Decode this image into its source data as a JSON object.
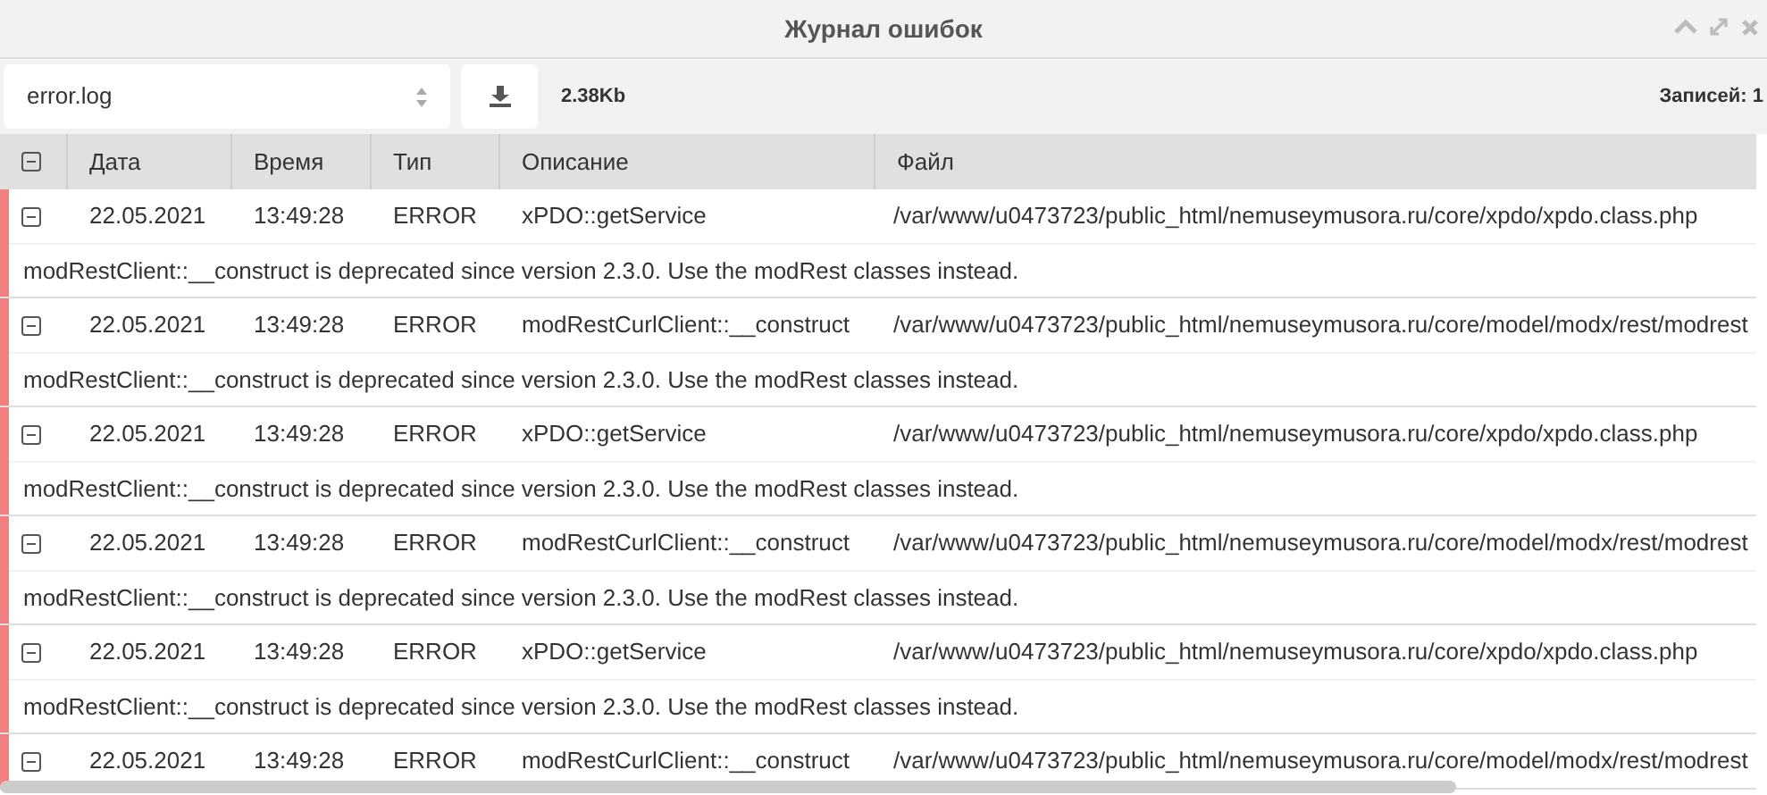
{
  "window": {
    "title": "Журнал ошибок"
  },
  "toolbar": {
    "file_select": {
      "value": "error.log"
    },
    "file_size": "2.38Kb",
    "records": "Записей: 1"
  },
  "table": {
    "columns": [
      "Дата",
      "Время",
      "Тип",
      "Описание",
      "Файл"
    ],
    "rows": [
      {
        "date": "22.05.2021",
        "time": "13:49:28",
        "type": "ERROR",
        "description": "xPDO::getService",
        "file": "/var/www/u0473723/public_html/nemuseymusora.ru/core/xpdo/xpdo.class.php",
        "expanded": true,
        "message": "modRestClient::__construct is deprecated since version 2.3.0. Use the modRest classes instead."
      },
      {
        "date": "22.05.2021",
        "time": "13:49:28",
        "type": "ERROR",
        "description": "modRestCurlClient::__construct",
        "file": "/var/www/u0473723/public_html/nemuseymusora.ru/core/model/modx/rest/modrest",
        "expanded": true,
        "message": "modRestClient::__construct is deprecated since version 2.3.0. Use the modRest classes instead."
      },
      {
        "date": "22.05.2021",
        "time": "13:49:28",
        "type": "ERROR",
        "description": "xPDO::getService",
        "file": "/var/www/u0473723/public_html/nemuseymusora.ru/core/xpdo/xpdo.class.php",
        "expanded": true,
        "message": "modRestClient::__construct is deprecated since version 2.3.0. Use the modRest classes instead."
      },
      {
        "date": "22.05.2021",
        "time": "13:49:28",
        "type": "ERROR",
        "description": "modRestCurlClient::__construct",
        "file": "/var/www/u0473723/public_html/nemuseymusora.ru/core/model/modx/rest/modrest",
        "expanded": true,
        "message": "modRestClient::__construct is deprecated since version 2.3.0. Use the modRest classes instead."
      },
      {
        "date": "22.05.2021",
        "time": "13:49:28",
        "type": "ERROR",
        "description": "xPDO::getService",
        "file": "/var/www/u0473723/public_html/nemuseymusora.ru/core/xpdo/xpdo.class.php",
        "expanded": true,
        "message": "modRestClient::__construct is deprecated since version 2.3.0. Use the modRest classes instead."
      },
      {
        "date": "22.05.2021",
        "time": "13:49:28",
        "type": "ERROR",
        "description": "modRestCurlClient::__construct",
        "file": "/var/www/u0473723/public_html/nemuseymusora.ru/core/model/modx/rest/modrest",
        "expanded": true
      }
    ]
  }
}
